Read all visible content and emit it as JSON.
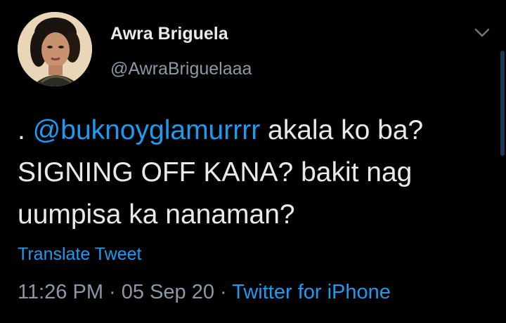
{
  "author": {
    "display_name": "Awra Briguela",
    "handle": "@AwraBriguelaaa"
  },
  "tweet": {
    "prefix": ". ",
    "mention": "@buknoygl​amurrrr",
    "body": " akala ko ba? SIGNING OFF KANA? bakit nag uumpisa ka nanaman?"
  },
  "translate_label": "Translate Tweet",
  "meta": {
    "time": "11:26 PM",
    "separator": " · ",
    "date": "05 Sep 20",
    "separator2": " · ",
    "source": "Twitter for iPhone"
  },
  "colors": {
    "background": "#000000",
    "link": "#1d9bf0",
    "secondary_text": "#8b98a5",
    "primary_text": "#e7e9ea"
  },
  "icons": {
    "caret": "chevron-down-icon"
  }
}
